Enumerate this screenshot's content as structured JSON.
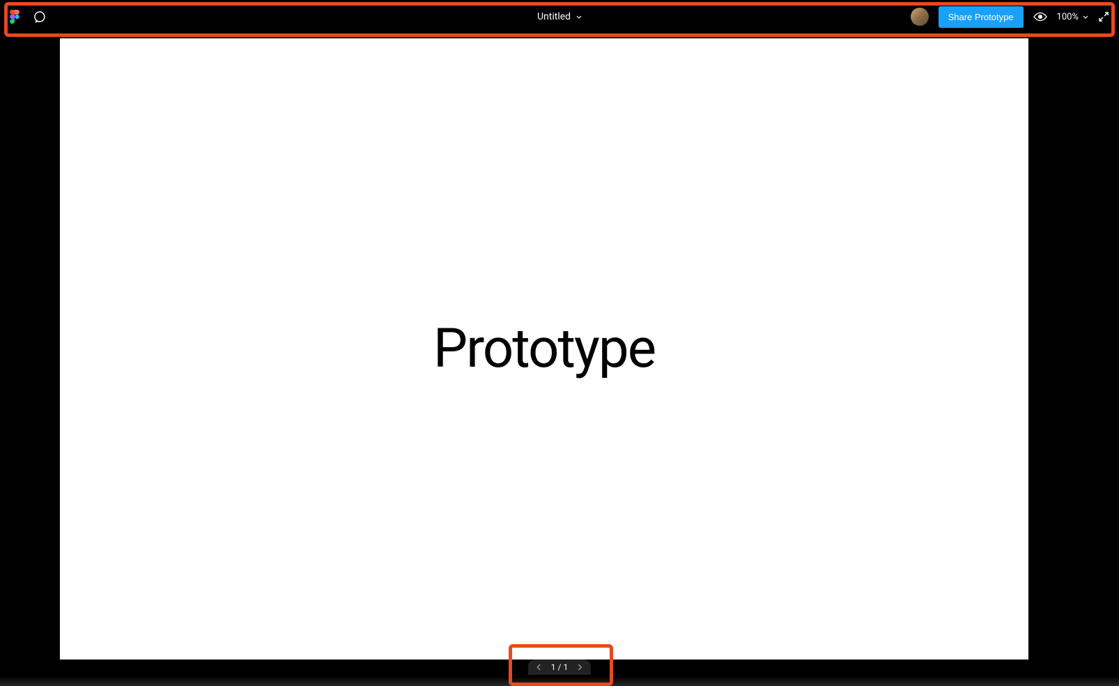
{
  "toolbar": {
    "file_title": "Untitled",
    "share_label": "Share Prototype",
    "zoom_level": "100%"
  },
  "canvas": {
    "main_text": "Prototype"
  },
  "footer": {
    "frame_indicator": "1 / 1"
  },
  "icons": {
    "figma_logo": "figma-logo",
    "comment": "comment-icon",
    "chevron_down": "chevron-down-icon",
    "avatar": "avatar",
    "eye": "eye-icon",
    "fullscreen": "fullscreen-icon",
    "chevron_left": "chevron-left-icon",
    "chevron_right": "chevron-right-icon"
  },
  "colors": {
    "accent": "#18a0fb",
    "annotation": "#e8491d",
    "background": "#000000",
    "canvas": "#ffffff"
  }
}
